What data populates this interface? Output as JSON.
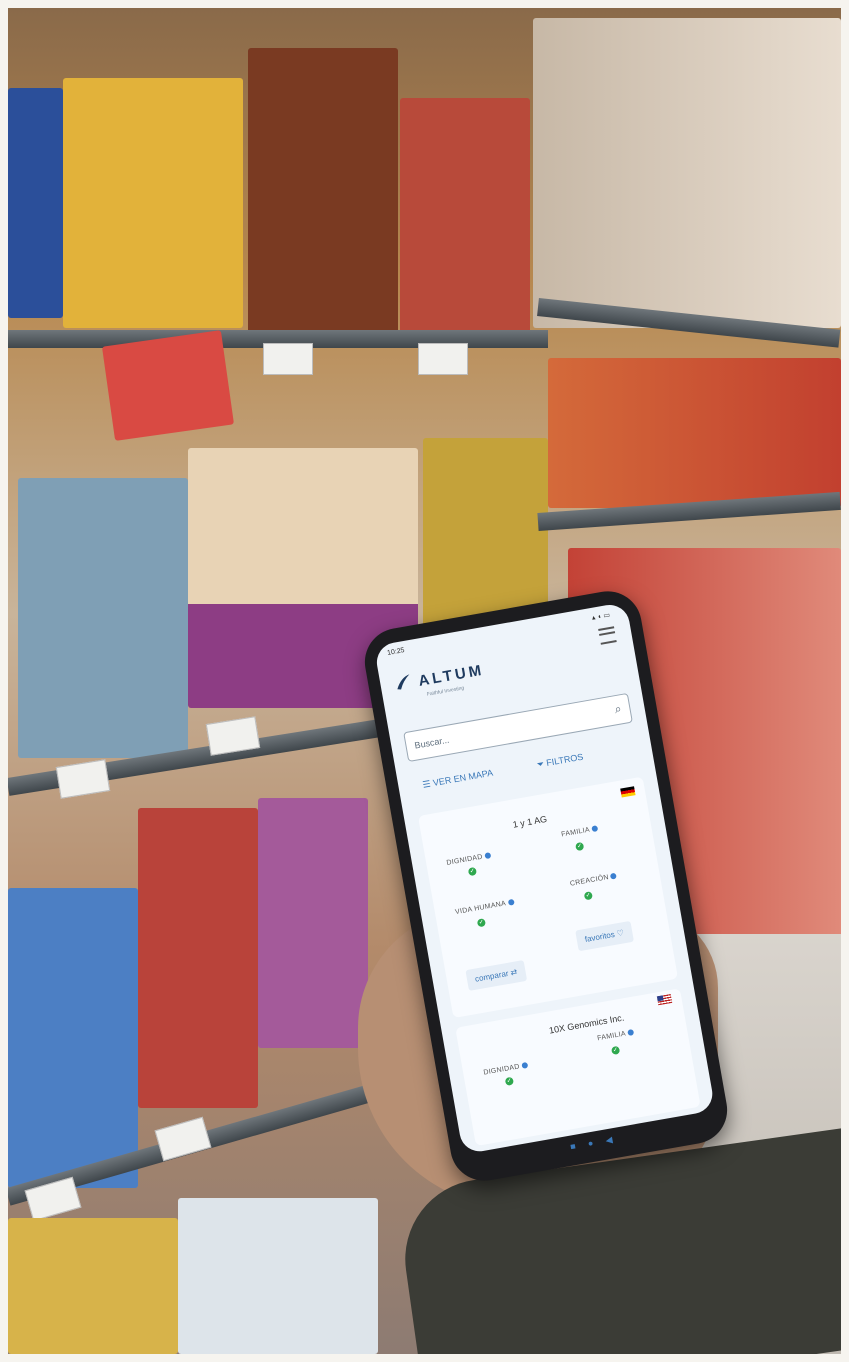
{
  "status_bar": {
    "time": "10:25"
  },
  "app": {
    "logo": "ALTUM",
    "tagline": "Faithful Investing"
  },
  "search": {
    "placeholder": "Buscar..."
  },
  "actions": {
    "map_label": "VER EN MAPA",
    "filters_label": "FILTROS"
  },
  "cards": [
    {
      "company": "1 y 1 AG",
      "flag": "de",
      "criteria": [
        {
          "label": "DIGNIDAD",
          "status": "ok"
        },
        {
          "label": "FAMILIA",
          "status": "ok"
        },
        {
          "label": "VIDA HUMANA",
          "status": "ok"
        },
        {
          "label": "CREACIÓN",
          "status": "ok"
        }
      ],
      "compare_label": "comparar",
      "favorites_label": "favoritos"
    },
    {
      "company": "10X Genomics Inc.",
      "flag": "us",
      "criteria": [
        {
          "label": "DIGNIDAD",
          "status": "ok"
        },
        {
          "label": "FAMILIA",
          "status": "ok"
        }
      ]
    }
  ],
  "icons": {
    "menu": "hamburger-icon",
    "search": "search-icon",
    "map": "list-icon",
    "filters": "filter-icon",
    "info": "info-icon",
    "ok": "check-circle-icon",
    "compare": "compare-icon",
    "favorite": "heart-icon"
  },
  "colors": {
    "accent": "#3a78b8",
    "ok": "#2fa84f",
    "screen_bg": "#eef4fa"
  }
}
